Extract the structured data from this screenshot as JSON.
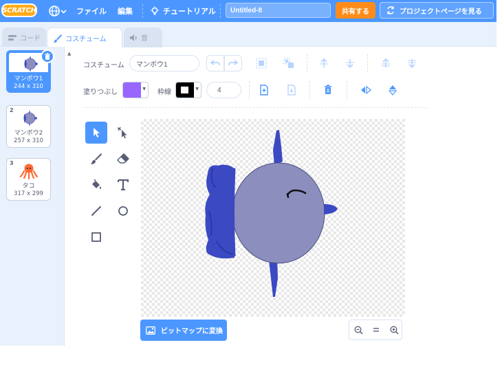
{
  "menu": {
    "logo_text": "SCRATCH",
    "file": "ファイル",
    "edit": "編集",
    "tutorial": "チュートリアル",
    "project_title": "Untitled-8",
    "share": "共有する",
    "see_project_page": "プロジェクトページを見る"
  },
  "tabs": {
    "code": "コード",
    "costumes": "コスチューム",
    "sounds": "音"
  },
  "costumes": [
    {
      "number": "1",
      "name": "マンボウ1",
      "size": "244 x 310",
      "selected": true
    },
    {
      "number": "2",
      "name": "マンボウ2",
      "size": "257 x 310",
      "selected": false
    },
    {
      "number": "3",
      "name": "タコ",
      "size": "317 x 299",
      "selected": false
    }
  ],
  "editor": {
    "costume_label": "コスチューム",
    "costume_name": "マンボウ1",
    "fill_label": "塗りつぶし",
    "fill_color": "#9966ff",
    "outline_label": "枠線",
    "outline_color": "#000000",
    "outline_width": "4",
    "convert_bitmap": "ビットマップに変換"
  },
  "colors": {
    "accent": "#4c97ff",
    "share": "#ff8c1a",
    "fish_body": "#8c8fbe",
    "fish_paint": "#3b49c2"
  }
}
